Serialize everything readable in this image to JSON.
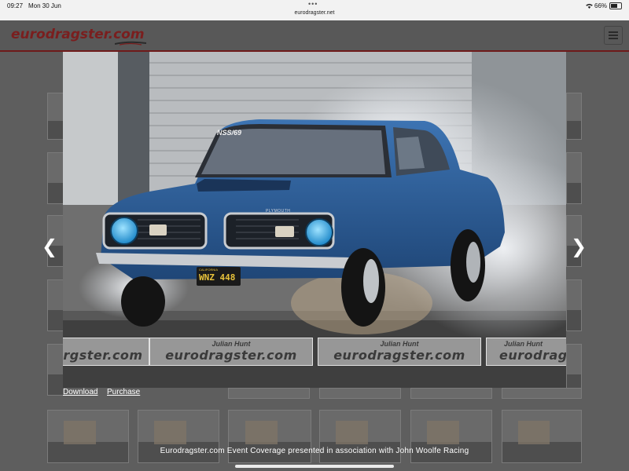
{
  "status_bar": {
    "time": "09:27",
    "date": "Mon 30 Jun",
    "dots": "•••",
    "url": "eurodragster.net",
    "battery": "66%"
  },
  "site": {
    "logo_text": "eurodragster.com"
  },
  "lightbox": {
    "windshield_text": "NSS/69",
    "car_badge": "PLYMOUTH",
    "plate_text": "WNZ 448",
    "plate_top": "CALIFORNIA",
    "watermarks": [
      {
        "photographer": "",
        "site": "rgster.com"
      },
      {
        "photographer": "Julian  Hunt",
        "site": "eurodragster.com"
      },
      {
        "photographer": "Julian  Hunt",
        "site": "eurodragster.com"
      },
      {
        "photographer": "Julian  Hunt",
        "site": "eurodrags"
      }
    ],
    "download_label": "Download",
    "purchase_label": "Purchase",
    "prev_label": "❮",
    "next_label": "❯"
  },
  "caption": "Eurodragster.com Event Coverage presented in association with John Woolfe Racing",
  "colors": {
    "logo": "#7a1e1e",
    "car_body": "#2f5f9a",
    "headlight": "#2aa6e8"
  }
}
